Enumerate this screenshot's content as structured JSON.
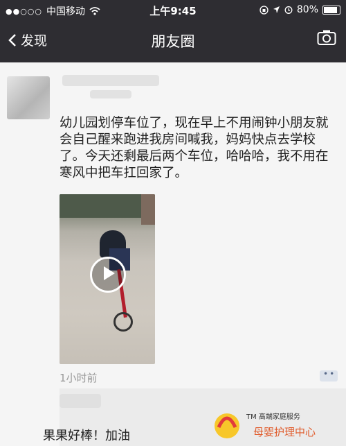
{
  "status_bar": {
    "carrier": "中国移动",
    "time": "上午9:45",
    "battery": "80%"
  },
  "nav": {
    "back_label": "发现",
    "title": "朋友圈"
  },
  "post": {
    "text": "幼儿园划停车位了，现在早上不用闹钟小朋友就会自己醒来跑进我房间喊我，妈妈快点去学校了。今天还剩最后两个车位，哈哈哈，我不用在寒风中把车扛回家了。",
    "time": "1小时前"
  },
  "comment": {
    "text": "果果好棒！加油"
  },
  "watermark": {
    "line1": "TM 高端家庭服务",
    "line2": "母婴护理中心"
  },
  "colors": {
    "nav_bg": "#2e2d32",
    "link": "#576b95"
  },
  "icons": [
    "signal-dots-icon",
    "wifi-icon",
    "location-icon",
    "alarm-icon",
    "battery-icon",
    "back-chevron-icon",
    "camera-icon",
    "play-icon"
  ]
}
